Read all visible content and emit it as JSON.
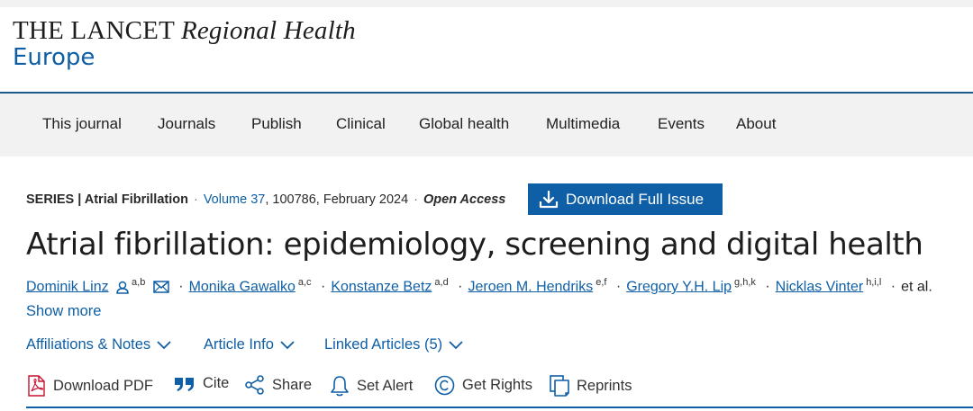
{
  "logo": {
    "brand": "THE LANCET",
    "sub_italic": "Regional Health",
    "region": "Europe"
  },
  "nav": {
    "items": [
      "This journal",
      "Journals",
      "Publish",
      "Clinical",
      "Global health",
      "Multimedia",
      "Events",
      "About"
    ]
  },
  "meta": {
    "series": "SERIES | Atrial Fibrillation",
    "volume_link": "Volume 37",
    "volume_rest": ", 100786, February 2024",
    "access": "Open Access"
  },
  "download_issue": {
    "label": "Download Full Issue",
    "icon": "download-icon"
  },
  "article": {
    "title": "Atrial fibrillation: epidemiology, screening and digital health"
  },
  "authors": {
    "list": [
      {
        "name": "Dominik Linz",
        "sup": "a,b"
      },
      {
        "name": "Monika Gawalko",
        "sup": "a,c"
      },
      {
        "name": "Konstanze Betz",
        "sup": "a,d"
      },
      {
        "name": "Jeroen M. Hendriks",
        "sup": "e,f"
      },
      {
        "name": "Gregory Y.H. Lip",
        "sup": "g,h,k"
      },
      {
        "name": "Nicklas Vinter",
        "sup": "h,i,l"
      }
    ],
    "separator": "·",
    "etal": "et al.",
    "show_more": "Show more"
  },
  "expanders": {
    "affiliations": "Affiliations & Notes",
    "article_info": "Article Info",
    "linked_articles": "Linked Articles (5)"
  },
  "toolbar": {
    "download_pdf": "Download PDF",
    "cite": "Cite",
    "share": "Share",
    "set_alert": "Set Alert",
    "get_rights": "Get Rights",
    "reprints": "Reprints"
  },
  "colors": {
    "accent": "#0f5fa6",
    "nav_bg": "#f2f2f2",
    "pdf_red": "#c8102e"
  }
}
